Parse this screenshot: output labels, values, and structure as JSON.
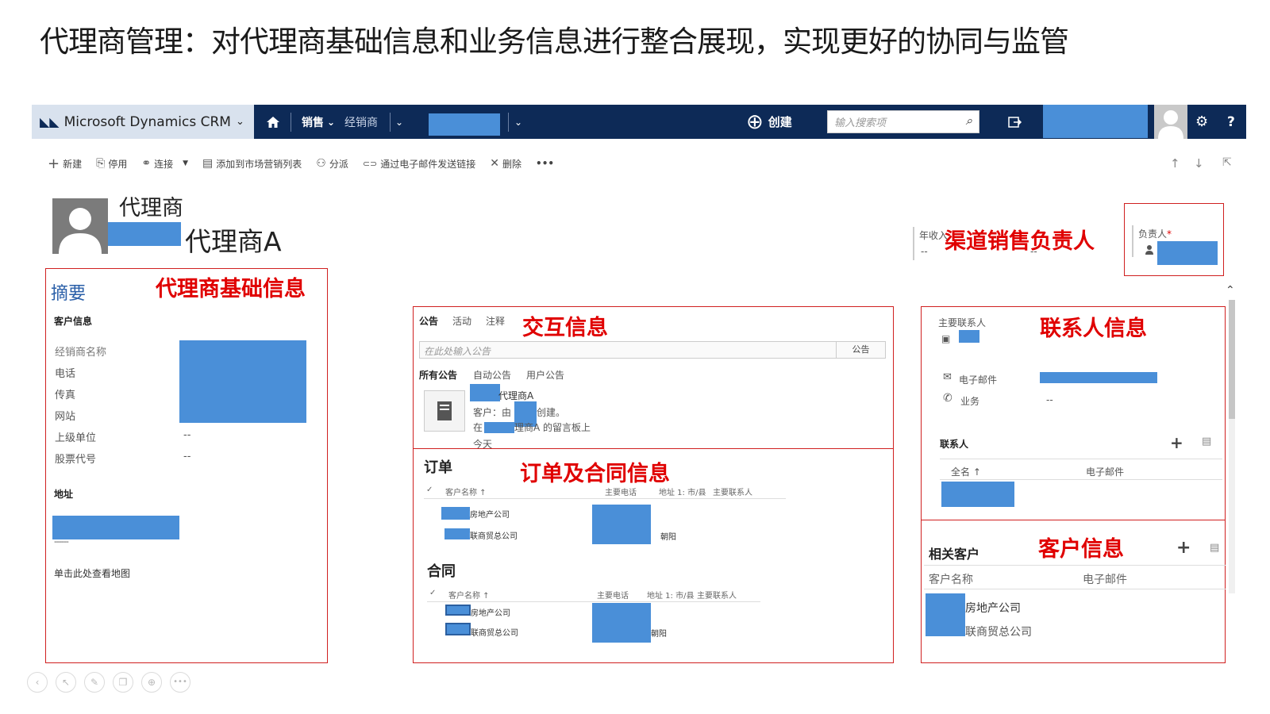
{
  "slide_title": "代理商管理：对代理商基础信息和业务信息进行整合展现，实现更好的协同与监管",
  "navbar": {
    "brand": "Microsoft Dynamics CRM",
    "brand_chevron": "⌄",
    "home_icon": "home-icon",
    "area": "销售",
    "area_chevron": "⌄",
    "entity": "经销商",
    "entity_chevron": "⌄",
    "record_chevron": "⌄",
    "create_label": "创建",
    "create_icon": "⊕",
    "search_placeholder": "输入搜索项",
    "search_icon": "⌕",
    "settings_icon": "⚙",
    "help_icon": "?",
    "colors": {
      "bar": "#0d2a57",
      "brand_bg": "#d9e2ee",
      "redacted": "#4a8fd8"
    }
  },
  "commands": [
    {
      "icon": "+",
      "label": "新建"
    },
    {
      "icon": "⎘",
      "label": "停用"
    },
    {
      "icon": "⚭",
      "label": "连接"
    },
    {
      "icon": "▤",
      "label": "添加到市场营销列表"
    },
    {
      "icon": "⚇",
      "label": "分派"
    },
    {
      "icon": "⊂⊃",
      "label": "通过电子邮件发送链接"
    },
    {
      "icon": "✕",
      "label": "删除"
    },
    {
      "icon": "",
      "label": "•••"
    }
  ],
  "nav_arrows": {
    "up": "↑",
    "down": "↓",
    "popout": "⇱"
  },
  "record": {
    "entity_type": "代理商",
    "name_suffix": "代理商A",
    "annual_revenue_label": "年收入",
    "annual_revenue_value": "--",
    "owner_label": "负责人",
    "owner_required": "*",
    "owner_field_dash": "--"
  },
  "annotations": {
    "channel_owner": "渠道销售负责人",
    "basic_info": "代理商基础信息",
    "interaction_info": "交互信息",
    "contact_info": "联系人信息",
    "order_contract_info": "订单及合同信息",
    "customer_info": "客户信息"
  },
  "summary": {
    "tab_title": "摘要",
    "account_info_heading": "客户信息",
    "fields": [
      "经销商名称",
      "电话",
      "传真",
      "网站",
      "上级单位",
      "股票代号"
    ],
    "parent_value": "--",
    "ticker_value": "--",
    "address_heading": "地址",
    "address_dashes": "------",
    "map_link": "单击此处查看地图"
  },
  "activity": {
    "tabs": [
      "公告",
      "活动",
      "注释"
    ],
    "post_placeholder": "在此处输入公告",
    "post_button": "公告",
    "filters": [
      "所有公告",
      "自动公告",
      "用户公告"
    ],
    "post_line1": "代理商A",
    "post_line2_prefix": "客户：由",
    "post_line2_suffix": "创建。",
    "post_line3_prefix": "在",
    "post_line3_suffix": "理商A 的留言板上",
    "post_time": "今天"
  },
  "orders": {
    "title": "订单",
    "columns": [
      "客户名称 ↑",
      "主要电话",
      "地址 1: 市/县",
      "主要联系人"
    ],
    "rows": [
      {
        "name": "房地产公司",
        "city": ""
      },
      {
        "name": "联商贸总公司",
        "city": "朝阳"
      }
    ]
  },
  "contracts": {
    "title": "合同",
    "columns": [
      "客户名称 ↑",
      "主要电话",
      "地址 1: 市/县",
      "主要联系人"
    ],
    "rows": [
      {
        "name": "房地产公司",
        "city": ""
      },
      {
        "name": "联商贸总公司",
        "city": "朝阳"
      }
    ]
  },
  "contacts": {
    "primary_contact_label": "主要联系人",
    "email_label": "电子邮件",
    "business_phone_label": "业务",
    "business_phone_value": "--",
    "subgrid_title": "联系人",
    "columns": [
      "全名 ↑",
      "电子邮件"
    ]
  },
  "related_accounts": {
    "title": "相关客户",
    "columns": [
      "客户名称",
      "电子邮件"
    ],
    "rows": [
      "房地产公司",
      "联商贸总公司"
    ]
  },
  "bottom_toolbar_icons": [
    "back-icon",
    "cursor-icon",
    "pen-icon",
    "copy-icon",
    "zoom-icon",
    "more-icon"
  ]
}
